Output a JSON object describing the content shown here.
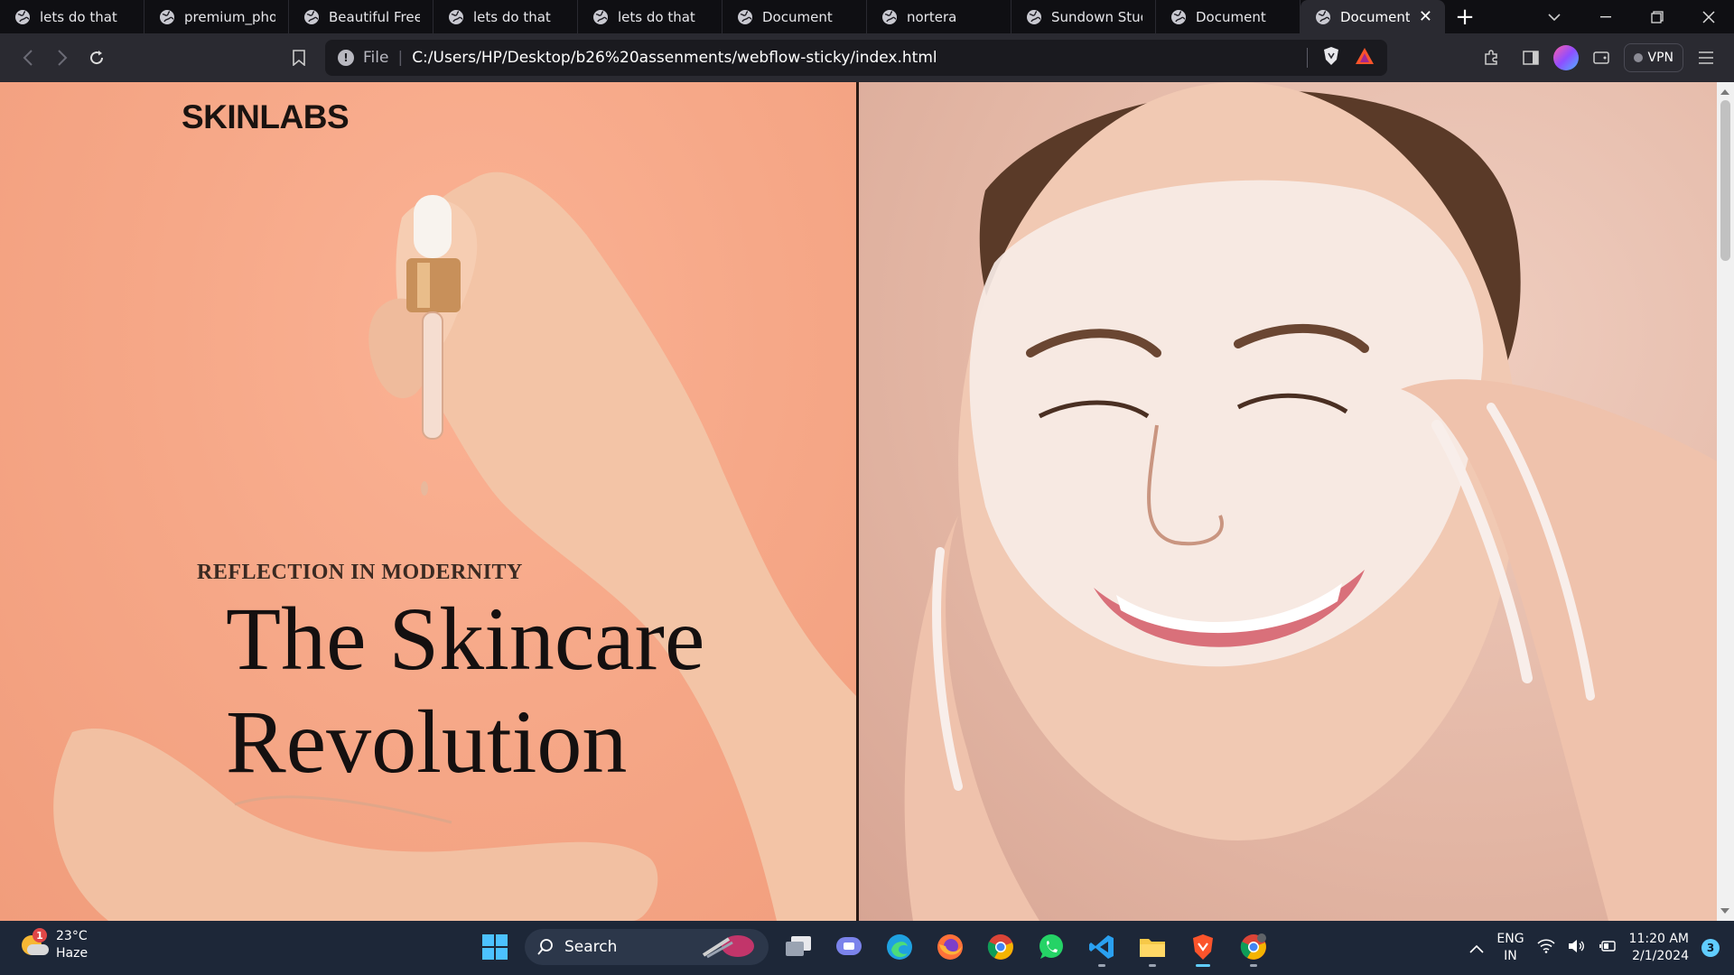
{
  "tabs": [
    {
      "title": "lets do that"
    },
    {
      "title": "premium_photo-"
    },
    {
      "title": "Beautiful Free Im"
    },
    {
      "title": "lets do that"
    },
    {
      "title": "lets do that"
    },
    {
      "title": "Document"
    },
    {
      "title": "nortera"
    },
    {
      "title": "Sundown Studio"
    },
    {
      "title": "Document"
    },
    {
      "title": "Document"
    }
  ],
  "active_tab_index": 9,
  "toolbar": {
    "url_scheme": "File",
    "url": "C:/Users/HP/Desktop/b26%20assenments/webflow-sticky/index.html",
    "vpn_label": "VPN"
  },
  "page": {
    "brand": "SKINLABS",
    "eyebrow": "REFLECTION IN MODERNITY",
    "headline_line1": "The Skincare",
    "headline_line2": "Revolution"
  },
  "taskbar": {
    "weather_temp": "23°C",
    "weather_desc": "Haze",
    "weather_badge": "1",
    "search_label": "Search",
    "lang_top": "ENG",
    "lang_bottom": "IN",
    "time": "11:20 AM",
    "date": "2/1/2024",
    "notification_count": "3"
  },
  "colors": {
    "left_panel_bg": "#f6a888",
    "right_panel_bg": "#e3b6a4",
    "taskbar_bg": "#1d2738",
    "accent": "#60cdff"
  }
}
